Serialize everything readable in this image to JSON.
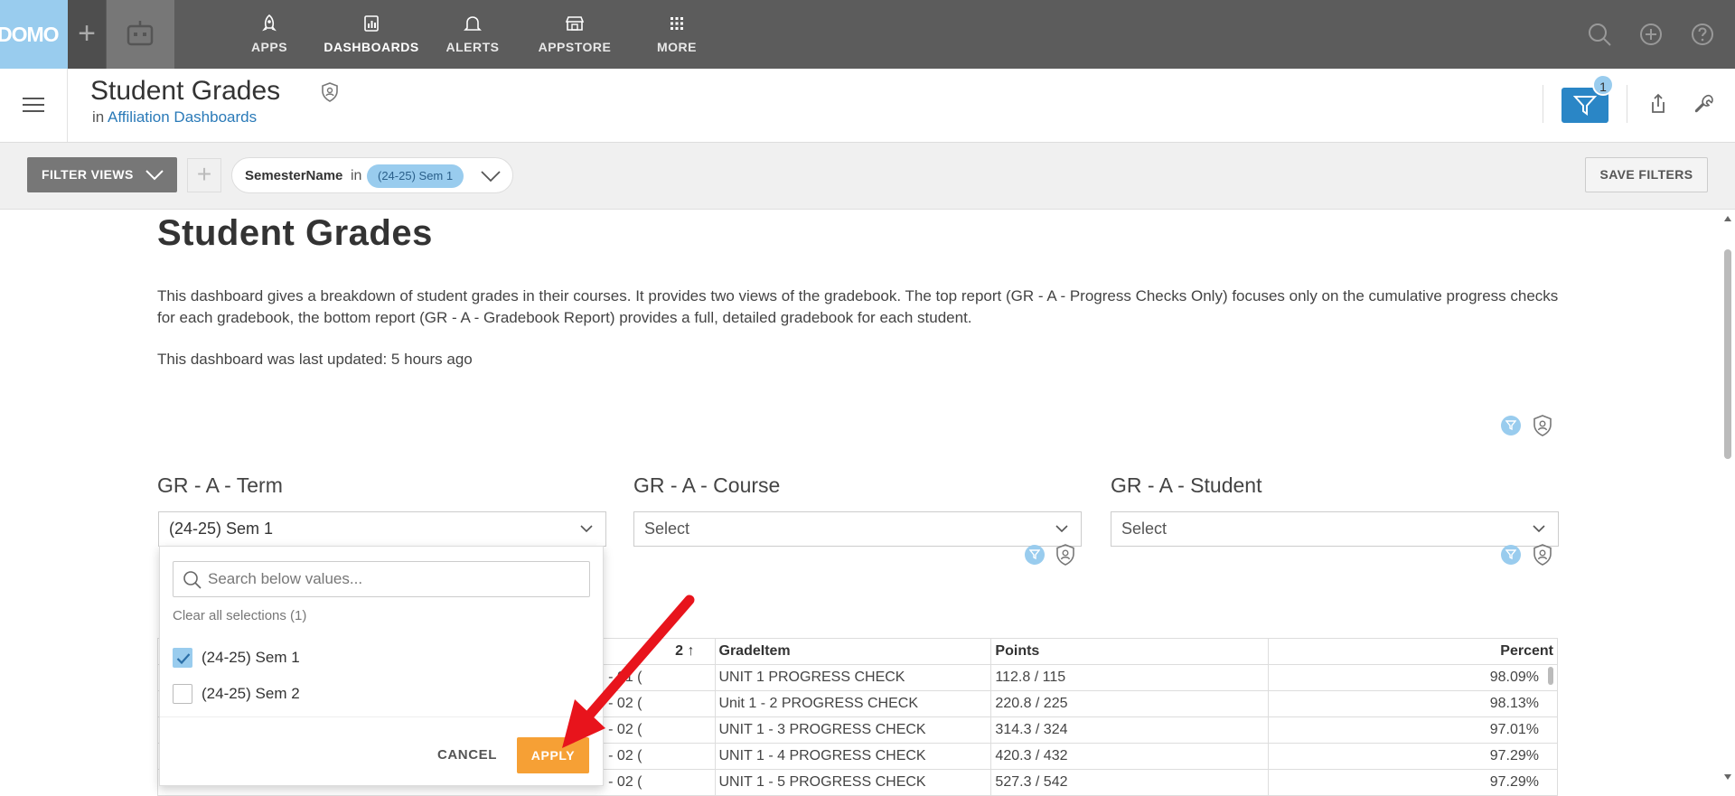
{
  "nav": {
    "logo": "DOMO",
    "items": [
      {
        "label": "APPS",
        "icon": "rocket-icon"
      },
      {
        "label": "DASHBOARDS",
        "icon": "dashboard-icon"
      },
      {
        "label": "ALERTS",
        "icon": "bell-icon"
      },
      {
        "label": "APPSTORE",
        "icon": "store-icon"
      },
      {
        "label": "MORE",
        "icon": "grid-icon"
      }
    ]
  },
  "header": {
    "title": "Student Grades",
    "in_prefix": "in",
    "parent_link": "Affiliation Dashboards",
    "filter_count": "1"
  },
  "filterbar": {
    "filter_views_label": "FILTER VIEWS",
    "pill_key": "SemesterName",
    "pill_op": "in",
    "pill_value": "(24-25) Sem 1",
    "save_label": "SAVE FILTERS"
  },
  "content": {
    "title": "Student Grades",
    "description": "This dashboard gives a breakdown of student grades in their courses. It provides two views of the gradebook. The top report (GR - A - Progress Checks Only) focuses only on the cumulative progress checks for each gradebook, the bottom report (GR - A - Gradebook Report) provides a full, detailed gradebook for each student.",
    "updated": "This dashboard was last updated: 5 hours ago"
  },
  "selectors": {
    "term": {
      "label": "GR - A - Term",
      "value": "(24-25) Sem 1"
    },
    "course": {
      "label": "GR - A - Course",
      "value": "Select"
    },
    "student": {
      "label": "GR - A - Student",
      "value": "Select"
    }
  },
  "dropdown": {
    "search_placeholder": "Search below values...",
    "clear_label": "Clear all selections (1)",
    "options": [
      {
        "label": "(24-25) Sem 1",
        "checked": true
      },
      {
        "label": "(24-25) Sem 2",
        "checked": false
      }
    ],
    "cancel_label": "CANCEL",
    "apply_label": "APPLY"
  },
  "table": {
    "headers": [
      "2",
      "GradeItem",
      "Points",
      "Percent"
    ],
    "rows": [
      {
        "c0": "- 01 (",
        "item": "UNIT 1 PROGRESS CHECK",
        "points": "112.8 / 115",
        "percent": "98.09%"
      },
      {
        "c0": "- 02 (",
        "item": "Unit 1 - 2 PROGRESS CHECK",
        "points": "220.8 / 225",
        "percent": "98.13%"
      },
      {
        "c0": "- 02 (",
        "item": "UNIT 1 - 3 PROGRESS CHECK",
        "points": "314.3 / 324",
        "percent": "97.01%"
      },
      {
        "c0": "- 02 (",
        "item": "UNIT 1 - 4 PROGRESS CHECK",
        "points": "420.3 / 432",
        "percent": "97.29%"
      },
      {
        "c0": "- 02 (",
        "item": "UNIT 1 - 5 PROGRESS CHECK",
        "points": "527.3 / 542",
        "percent": "97.29%"
      }
    ]
  },
  "colors": {
    "nav_bg": "#5c5c5c",
    "accent_blue": "#2a86c6",
    "light_blue": "#99ccee",
    "apply_orange": "#f6a035",
    "annotation_red": "#e8141c"
  }
}
